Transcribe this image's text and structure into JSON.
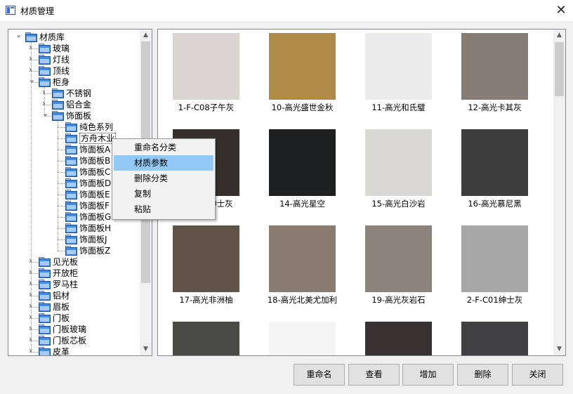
{
  "window": {
    "title": "材质管理",
    "close_glyph": "✕"
  },
  "tree": {
    "nodes": [
      {
        "label": "材质库",
        "level": 0,
        "expanded": true
      },
      {
        "label": "玻璃",
        "level": 1,
        "expanded": false
      },
      {
        "label": "灯线",
        "level": 1,
        "expanded": false
      },
      {
        "label": "顶线",
        "level": 1,
        "expanded": false
      },
      {
        "label": "柜身",
        "level": 1,
        "expanded": true
      },
      {
        "label": "不锈钢",
        "level": 2,
        "expanded": false
      },
      {
        "label": "铝合金",
        "level": 2,
        "expanded": false
      },
      {
        "label": "饰面板",
        "level": 2,
        "expanded": true
      },
      {
        "label": "纯色系列",
        "level": 3
      },
      {
        "label": "方舟木业",
        "level": 3,
        "selected": true
      },
      {
        "label": "饰面板A",
        "level": 3
      },
      {
        "label": "饰面板B",
        "level": 3
      },
      {
        "label": "饰面板C",
        "level": 3
      },
      {
        "label": "饰面板D",
        "level": 3
      },
      {
        "label": "饰面板E",
        "level": 3
      },
      {
        "label": "饰面板F",
        "level": 3
      },
      {
        "label": "饰面板G",
        "level": 3
      },
      {
        "label": "饰面板H",
        "level": 3
      },
      {
        "label": "饰面板J",
        "level": 3
      },
      {
        "label": "饰面板Z",
        "level": 3
      },
      {
        "label": "见光板",
        "level": 1,
        "expanded": false
      },
      {
        "label": "开放柜",
        "level": 1,
        "expanded": false
      },
      {
        "label": "罗马柱",
        "level": 1,
        "expanded": false
      },
      {
        "label": "铝材",
        "level": 1,
        "expanded": false
      },
      {
        "label": "眉板",
        "level": 1,
        "expanded": false
      },
      {
        "label": "门板",
        "level": 1,
        "expanded": false
      },
      {
        "label": "门板玻璃",
        "level": 1,
        "expanded": false
      },
      {
        "label": "门板芯板",
        "level": 1,
        "expanded": false
      },
      {
        "label": "皮革",
        "level": 1,
        "expanded": false
      }
    ]
  },
  "context_menu": {
    "items": [
      {
        "label": "重命名分类",
        "highlighted": false
      },
      {
        "label": "材质参数",
        "highlighted": true
      },
      {
        "label": "删除分类",
        "highlighted": false
      },
      {
        "label": "复制",
        "highlighted": false
      },
      {
        "label": "粘贴",
        "highlighted": false
      }
    ]
  },
  "materials": [
    {
      "label": "1-F-C08子午灰",
      "color": "#d8d4cf"
    },
    {
      "label": "10-高光盛世金秋",
      "color": "#b08a47"
    },
    {
      "label": "11-高光和氏璧",
      "color": "#ececec"
    },
    {
      "label": "12-高光卡其灰",
      "color": "#867d76"
    },
    {
      "label": "13-高光绅士灰",
      "color": "#35302b"
    },
    {
      "label": "14-高光星空",
      "color": "#1d1f21"
    },
    {
      "label": "15-高光白沙岩",
      "color": "#d9d8d4"
    },
    {
      "label": "16-高光慕尼黑",
      "color": "#3d3d3e"
    },
    {
      "label": "17-高光非洲柚",
      "color": "#605449"
    },
    {
      "label": "18-高光北美尤加利",
      "color": "#8a7c71"
    },
    {
      "label": "19-高光灰岩石",
      "color": "#8c847b"
    },
    {
      "label": "2-F-C01绅士灰",
      "color": "#a7a7a7"
    },
    {
      "label": "",
      "color": "#4a4b47"
    },
    {
      "label": "",
      "color": "#f5f5f5"
    },
    {
      "label": "",
      "color": "#363232"
    },
    {
      "label": "",
      "color": "#414144"
    }
  ],
  "buttons": [
    {
      "label": "重命名"
    },
    {
      "label": "查看"
    },
    {
      "label": "增加"
    },
    {
      "label": "删除"
    },
    {
      "label": "关闭"
    }
  ]
}
